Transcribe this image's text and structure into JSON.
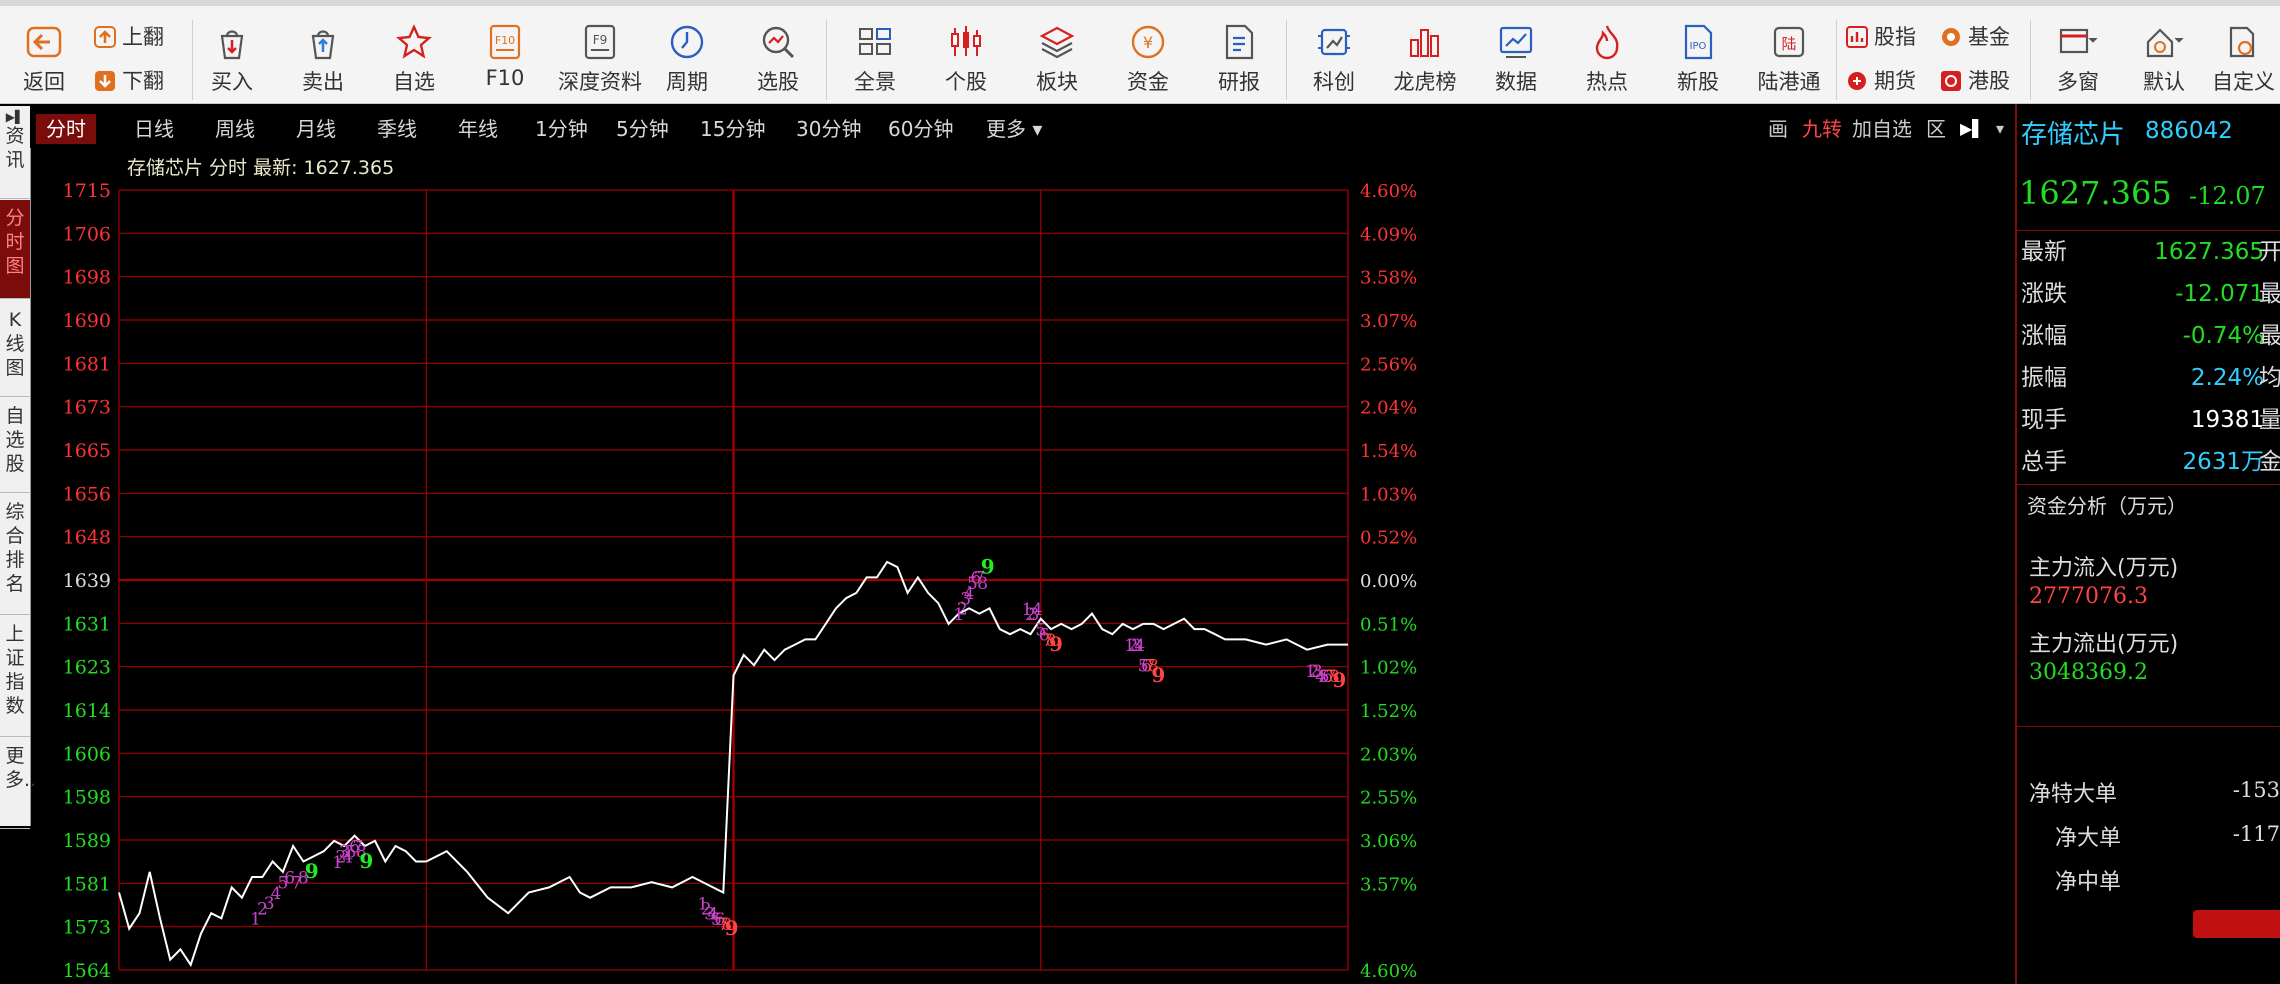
{
  "toolbar": {
    "back_label": "返回",
    "page_up_label": "上翻",
    "page_down_label": "下翻",
    "buy_label": "买入",
    "sell_label": "卖出",
    "watchlist_label": "自选",
    "f10_label": "F10",
    "f10_icon_text": "F10",
    "deep_data_label": "深度资料",
    "f9_icon_text": "F9",
    "period_label": "周期",
    "stock_pick_label": "选股",
    "overview_label": "全景",
    "individual_label": "个股",
    "sector_label": "板块",
    "funds_label": "资金",
    "research_label": "研报",
    "star_market_label": "科创",
    "dragon_tiger_label": "龙虎榜",
    "data_label": "数据",
    "hot_label": "热点",
    "ipo_label": "新股",
    "ipo_icon_text": "IPO",
    "hk_connect_label": "陆港通",
    "hk_connect_icon_text": "陆",
    "stock_index_label": "股指",
    "fund_label": "基金",
    "futures_label": "期货",
    "hk_stock_label": "港股",
    "multi_window_label": "多窗",
    "default_label": "默认",
    "custom_label": "自定义",
    "yuan_icon_text": "¥"
  },
  "left_tabs": [
    "资讯",
    "分时图",
    "K线图",
    "自选股",
    "综合排名",
    "上证指数",
    "更多.."
  ],
  "period_tabs": [
    "分时",
    "日线",
    "周线",
    "月线",
    "季线",
    "年线",
    "1分钟",
    "5分钟",
    "15分钟",
    "30分钟",
    "60分钟",
    "更多 ▾"
  ],
  "chart_tools": {
    "draw": "画",
    "nine_turn": "九转",
    "add_watch": "加自选",
    "zone": "区",
    "collapse_icon": "▶▌",
    "menu_icon": "▾"
  },
  "chart_title": "存储芯片 分时 最新: 1627.365",
  "right_panel": {
    "stock_name": "存储芯片",
    "stock_code": "886042",
    "price": "1627.365",
    "change_head": "-12.07",
    "rows": [
      {
        "k": "最新",
        "v": "1627.365",
        "x": "开",
        "color": "#22dd22"
      },
      {
        "k": "涨跌",
        "v": "-12.071",
        "x": "最",
        "color": "#22dd22"
      },
      {
        "k": "涨幅",
        "v": "-0.74%",
        "x": "最",
        "color": "#22dd22"
      },
      {
        "k": "振幅",
        "v": "2.24%",
        "x": "均",
        "color": "#33ccff"
      },
      {
        "k": "现手",
        "v": "19381",
        "x": "量",
        "color": "#ffffff"
      },
      {
        "k": "总手",
        "v": "2631万",
        "x": "金",
        "color": "#33ccff"
      }
    ],
    "fund_analysis_title": "资金分析（万元）",
    "inflow_label": "主力流入(万元)",
    "inflow_value": "2777076.3",
    "outflow_label": "主力流出(万元)",
    "outflow_value": "3048369.2",
    "net_rows": [
      {
        "k": "净特大单",
        "v": "-153"
      },
      {
        "k": "净大单",
        "v": "-117"
      },
      {
        "k": "净中单",
        "v": ""
      }
    ]
  },
  "colors": {
    "up": "#ff3333",
    "down": "#22dd22",
    "grid": "#a00000",
    "line": "#ffffff",
    "td_count": "#cc44cc",
    "td_nine_red": "#ff4444",
    "td_nine_green": "#22ee22"
  },
  "chart_data": {
    "type": "line",
    "title": "存储芯片 分时 最新: 1627.365",
    "prev_close": 1639,
    "ylim": [
      1564,
      1715
    ],
    "y_ticks": [
      "1715",
      "1706",
      "1698",
      "1690",
      "1681",
      "1673",
      "1665",
      "1656",
      "1648",
      "1639",
      "1631",
      "1623",
      "1614",
      "1606",
      "1598",
      "1589",
      "1581",
      "1573",
      "1564"
    ],
    "pct_ticks": [
      "4.60%",
      "4.09%",
      "3.58%",
      "3.07%",
      "2.56%",
      "2.04%",
      "1.54%",
      "1.03%",
      "0.52%",
      "0.00%",
      "0.51%",
      "1.02%",
      "1.52%",
      "2.03%",
      "2.55%",
      "3.06%",
      "3.57%",
      "4.60%"
    ],
    "session_minutes": 240,
    "series": [
      {
        "x": [
          0,
          2,
          4,
          6,
          8,
          10,
          12,
          14,
          16,
          18,
          20,
          22,
          24,
          26,
          28,
          30,
          32,
          34,
          36,
          38,
          40,
          42,
          44,
          46,
          48,
          50,
          52,
          54,
          56,
          58,
          60,
          64,
          68,
          72,
          76,
          80,
          84,
          88,
          90,
          92,
          96,
          100,
          104,
          108,
          112,
          116,
          118,
          119,
          120,
          122,
          124,
          126,
          128,
          130,
          132,
          134,
          136,
          138,
          140,
          142,
          144,
          146,
          148,
          150,
          152,
          154,
          156,
          158,
          160,
          162,
          164,
          166,
          168,
          170,
          172,
          174,
          176,
          178,
          180,
          182,
          184,
          186,
          188,
          190,
          192,
          194,
          196,
          198,
          200,
          202,
          204,
          206,
          208,
          210,
          212,
          214,
          216,
          218,
          220,
          224,
          228,
          232,
          236,
          240
        ],
        "y": [
          1579,
          1572,
          1575,
          1583,
          1574,
          1566,
          1568,
          1565,
          1571,
          1575,
          1574,
          1580,
          1578,
          1582,
          1582,
          1585,
          1583,
          1588,
          1585,
          1586,
          1587,
          1589,
          1588,
          1590,
          1588,
          1589,
          1585,
          1588,
          1587,
          1585,
          1585,
          1587,
          1583,
          1578,
          1575,
          1579,
          1580,
          1582,
          1579,
          1578,
          1580,
          1580,
          1581,
          1580,
          1582,
          1580,
          1579,
          1600,
          1621,
          1625,
          1623,
          1626,
          1624,
          1626,
          1627,
          1628,
          1628,
          1631,
          1634,
          1636,
          1637,
          1640,
          1640,
          1643,
          1642,
          1637,
          1640,
          1637,
          1635,
          1631,
          1633,
          1634,
          1633,
          1634,
          1630,
          1629,
          1630,
          1629,
          1632,
          1630,
          1631,
          1630,
          1631,
          1633,
          1630,
          1629,
          1631,
          1630,
          1631,
          1631,
          1630,
          1631,
          1632,
          1630,
          1630,
          1629,
          1628,
          1628,
          1628,
          1627,
          1628,
          1626,
          1627,
          1627
        ]
      }
    ],
    "td_sequences": [
      {
        "x": [
          39,
          41,
          43,
          45,
          47,
          49,
          51,
          53,
          55
        ],
        "y": [
          1572,
          1574,
          1575,
          1577,
          1579,
          1580,
          1579,
          1580,
          1581
        ],
        "last_color": "green"
      },
      {
        "x": [
          63,
          64,
          65,
          66,
          67,
          68,
          69,
          70,
          71
        ],
        "y": [
          1583,
          1584,
          1585,
          1584,
          1585,
          1586,
          1586,
          1585,
          1583
        ],
        "last_color": "green"
      },
      {
        "x": [
          170,
          171,
          172,
          173,
          174,
          175,
          176,
          177,
          178
        ],
        "y": [
          1580,
          1579,
          1578,
          1578,
          1577,
          1577,
          1576,
          1576,
          1575
        ],
        "last_color": "red"
      },
      {
        "x": [
          245,
          246,
          247,
          248,
          249,
          250,
          251,
          252,
          253
        ],
        "y": [
          1631,
          1632,
          1634,
          1635,
          1637,
          1638,
          1638,
          1637,
          1640
        ],
        "last_color": "green"
      },
      {
        "x": [
          265,
          266,
          267,
          268,
          269,
          270,
          271,
          272,
          273
        ],
        "y": [
          1637,
          1636,
          1636,
          1637,
          1633,
          1632,
          1631,
          1631,
          1630
        ],
        "last_color": "red"
      },
      {
        "x": [
          295,
          296,
          297,
          298,
          299,
          300,
          301,
          302,
          303
        ],
        "y": [
          1630,
          1630,
          1630,
          1630,
          1626,
          1626,
          1626,
          1626,
          1624
        ],
        "last_color": "red"
      },
      {
        "x": [
          348,
          349,
          350,
          351,
          352,
          353,
          354,
          355,
          356
        ],
        "y": [
          1625,
          1625,
          1625,
          1624,
          1624,
          1624,
          1624,
          1624,
          1623
        ],
        "last_color": "red"
      }
    ]
  }
}
